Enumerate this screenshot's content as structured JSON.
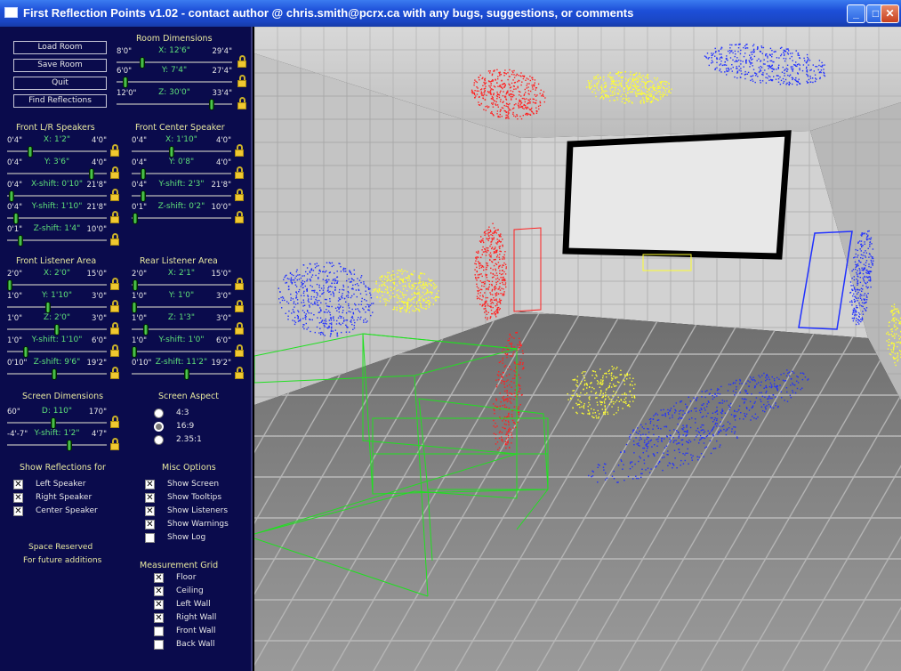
{
  "window": {
    "title": "First Reflection Points v1.02 - contact author @ chris.smith@pcrx.ca with any bugs, suggestions, or comments",
    "minimize": "_",
    "maximize": "□",
    "close": "✕"
  },
  "buttons": {
    "load": "Load Room",
    "save": "Save Room",
    "quit": "Quit",
    "find": "Find Reflections"
  },
  "room": {
    "header": "Room Dimensions",
    "x": {
      "min": "8'0\"",
      "label": "X: 12'6\"",
      "max": "29'4\"",
      "level": 0.21
    },
    "y": {
      "min": "6'0\"",
      "label": "Y: 7'4\"",
      "max": "27'4\"",
      "level": 0.06
    },
    "z": {
      "min": "12'0\"",
      "label": "Z: 30'0\"",
      "max": "33'4\"",
      "level": 0.84
    }
  },
  "front_lr": {
    "header": "Front L/R Speakers",
    "x": {
      "min": "0'4\"",
      "label": "X: 1'2\"",
      "max": "4'0\"",
      "level": 0.22
    },
    "y": {
      "min": "0'4\"",
      "label": "Y: 3'6\"",
      "max": "4'0\"",
      "level": 0.87
    },
    "xshift": {
      "min": "0'4\"",
      "label": "X-shift: 0'10\"",
      "max": "21'8\"",
      "level": 0.02
    },
    "yshift": {
      "min": "0'4\"",
      "label": "Y-shift: 1'10\"",
      "max": "21'8\"",
      "level": 0.07
    },
    "zshift": {
      "min": "0'1\"",
      "label": "Z-shift: 1'4\"",
      "max": "10'0\"",
      "level": 0.11
    }
  },
  "front_center": {
    "header": "Front Center Speaker",
    "x": {
      "min": "0'4\"",
      "label": "X: 1'10\"",
      "max": "4'0\"",
      "level": 0.4
    },
    "y": {
      "min": "0'4\"",
      "label": "Y: 0'8\"",
      "max": "4'0\"",
      "level": 0.09
    },
    "xshift": {
      "min": "0'4\"",
      "label": "Y-shift: 2'3\"",
      "max": "21'8\"",
      "level": 0.09
    },
    "zshift": {
      "min": "0'1\"",
      "label": "Z-shift: 0'2\"",
      "max": "10'0\"",
      "level": 0.01
    }
  },
  "front_listener": {
    "header": "Front Listener Area",
    "x": {
      "min": "2'0\"",
      "label": "X: 2'0\"",
      "max": "15'0\"",
      "level": 0.0
    },
    "y": {
      "min": "1'0\"",
      "label": "Y: 1'10\"",
      "max": "3'0\"",
      "level": 0.41
    },
    "z": {
      "min": "1'0\"",
      "label": "Z: 2'0\"",
      "max": "3'0\"",
      "level": 0.5
    },
    "yshift": {
      "min": "1'0\"",
      "label": "Y-shift: 1'10\"",
      "max": "6'0\"",
      "level": 0.17
    },
    "zshift": {
      "min": "0'10\"",
      "label": "Z-shift: 9'6\"",
      "max": "19'2\"",
      "level": 0.47
    }
  },
  "rear_listener": {
    "header": "Rear Listener Area",
    "x": {
      "min": "2'0\"",
      "label": "X: 2'1\"",
      "max": "15'0\"",
      "level": 0.01
    },
    "y": {
      "min": "1'0\"",
      "label": "Y: 1'0\"",
      "max": "3'0\"",
      "level": 0.0
    },
    "z": {
      "min": "1'0\"",
      "label": "Z: 1'3\"",
      "max": "3'0\"",
      "level": 0.12
    },
    "yshift": {
      "min": "1'0\"",
      "label": "Y-shift: 1'0\"",
      "max": "6'0\"",
      "level": 0.0
    },
    "zshift": {
      "min": "0'10\"",
      "label": "Z-shift: 11'2\"",
      "max": "19'2\"",
      "level": 0.56
    }
  },
  "screen": {
    "header": "Screen Dimensions",
    "d": {
      "min": "60\"",
      "label": "D: 110\"",
      "max": "170\"",
      "level": 0.46
    },
    "yshift": {
      "min": "-4'-7\"",
      "label": "Y-shift: 1'2\"",
      "max": "4'7\"",
      "level": 0.63
    }
  },
  "aspect": {
    "header": "Screen Aspect",
    "options": [
      "4:3",
      "16:9",
      "2.35:1"
    ],
    "selected": 1
  },
  "reflections": {
    "header": "Show Reflections for",
    "items": [
      {
        "label": "Left Speaker",
        "checked": true
      },
      {
        "label": "Right Speaker",
        "checked": true
      },
      {
        "label": "Center Speaker",
        "checked": true
      }
    ]
  },
  "misc": {
    "header": "Misc Options",
    "items": [
      {
        "label": "Show Screen",
        "checked": true
      },
      {
        "label": "Show Tooltips",
        "checked": true
      },
      {
        "label": "Show Listeners",
        "checked": true
      },
      {
        "label": "Show Warnings",
        "checked": true
      },
      {
        "label": "Show Log",
        "checked": false
      }
    ]
  },
  "reserved": {
    "line1": "Space Reserved",
    "line2": "For future additions"
  },
  "grid": {
    "header": "Measurement Grid",
    "items": [
      {
        "label": "Floor",
        "checked": true
      },
      {
        "label": "Ceiling",
        "checked": true
      },
      {
        "label": "Left Wall",
        "checked": true
      },
      {
        "label": "Right Wall",
        "checked": true
      },
      {
        "label": "Front Wall",
        "checked": false
      },
      {
        "label": "Back Wall",
        "checked": false
      }
    ]
  },
  "colors": {
    "left": "#ff2020",
    "right": "#2030ff",
    "center": "#ffff30",
    "listener": "#20e020"
  }
}
